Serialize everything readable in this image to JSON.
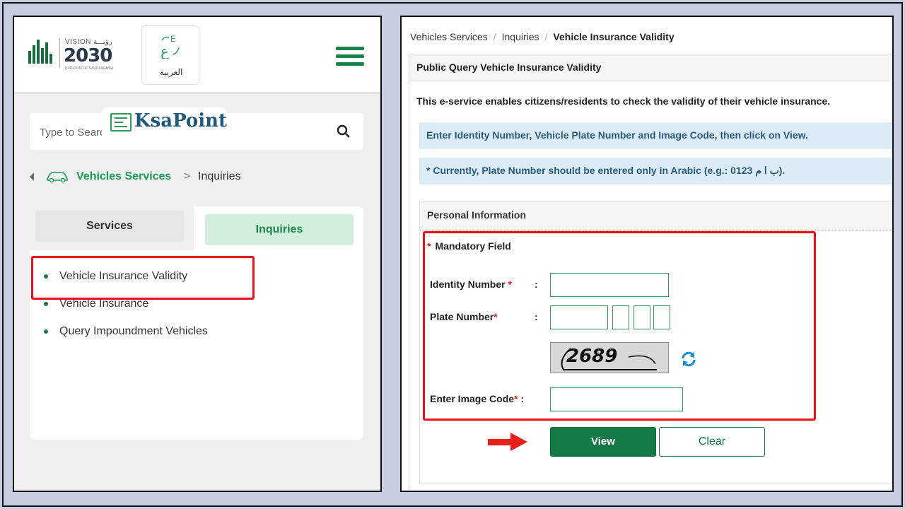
{
  "left": {
    "vision": {
      "label": "VISION",
      "arabic_label": "رؤيـــة",
      "year": "2030",
      "sub": "KINGDOM OF SAUDI ARABIA"
    },
    "language_button": {
      "label": "العربية",
      "icon": "language-switch-icon"
    },
    "menu_icon": "hamburger-menu-icon",
    "search": {
      "placeholder": "Type to Search",
      "icon": "search-icon"
    },
    "watermark": {
      "text": "KsaPoint"
    },
    "breadcrumb": {
      "link": "Vehicles Services",
      "separator": ">",
      "current": "Inquiries",
      "icon": "car-icon"
    },
    "tabs": [
      {
        "label": "Services",
        "active": false
      },
      {
        "label": "Inquiries",
        "active": true
      }
    ],
    "inquiries": [
      {
        "label": "Vehicle Insurance Validity"
      },
      {
        "label": "Vehicle Insurance"
      },
      {
        "label": "Query Impoundment Vehicles"
      }
    ]
  },
  "right": {
    "breadcrumb": {
      "part1": "Vehicles Services",
      "part2": "Inquiries",
      "current": "Vehicle Insurance Validity",
      "separator": "/"
    },
    "page_title": "Public Query Vehicle Insurance Validity",
    "intro": "This e-service enables citizens/residents to check the validity of their vehicle insurance.",
    "info1": "Enter Identity Number, Vehicle Plate Number and Image Code, then click on View.",
    "info2": "* Currently, Plate Number should be entered only in Arabic (e.g.: 0123 ب ا م).",
    "section_title": "Personal Information",
    "mandatory_star": "*",
    "mandatory_note": "Mandatory Field",
    "fields": {
      "identity_label": "Identity Number",
      "plate_label": "Plate Number",
      "image_code_label": "Enter Image Code",
      "star": "*",
      "colon": ":",
      "identity_value": "",
      "plate_value": "",
      "image_code_value": ""
    },
    "captcha_text": "2689",
    "buttons": {
      "view": "View",
      "clear": "Clear"
    }
  },
  "colors": {
    "brand_green": "#157a45",
    "highlight_red": "#e8101c",
    "info_blue": "#dcecf7"
  }
}
